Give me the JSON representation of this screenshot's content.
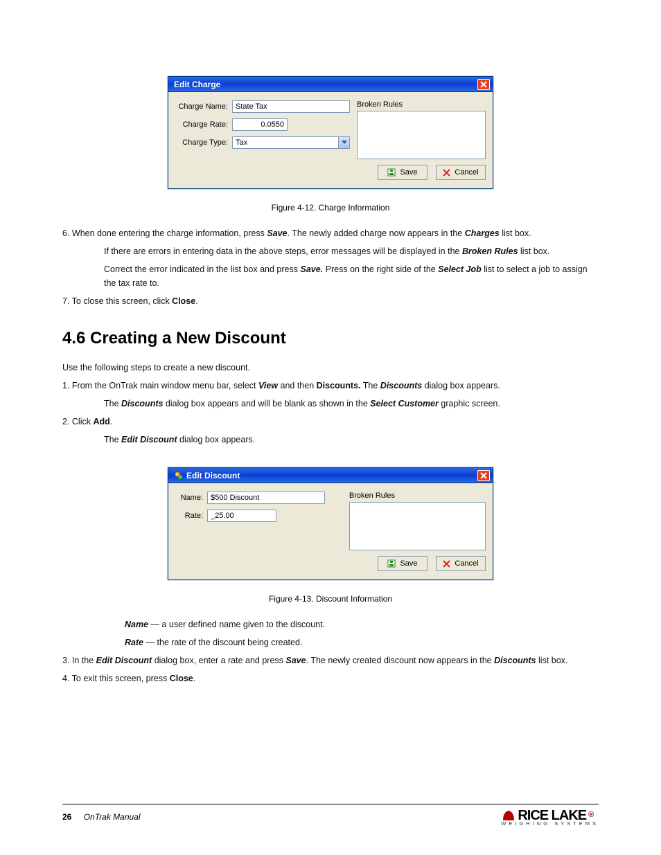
{
  "dialog1": {
    "title": "Edit Charge",
    "close_icon": "close-icon",
    "labels": {
      "name": "Charge Name:",
      "rate": "Charge Rate:",
      "type": "Charge Type:"
    },
    "values": {
      "name": "State Tax",
      "rate": "0.0550",
      "type": "Tax"
    },
    "broken_label": "Broken Rules",
    "save": "Save",
    "cancel": "Cancel"
  },
  "caption1": "Figure 4-12. Charge Information",
  "text1": {
    "step6a": "6. When done entering the charge information, press ",
    "step6b": ". The newly added charge now appears in the ",
    "listbox": "Charges",
    "step6c": " list box.",
    "note1a": "If there are errors in entering data in the above steps, error messages will be displayed in the ",
    "broken": "Broken Rules",
    "note1b": " list box.",
    "note2a": "Correct the error indicated in the list box and press ",
    "note2b": "Press on the right side of the ",
    "selectjob": "Select Job",
    "note2c": " list to select a job to assign the tax rate to.",
    "step7a": "7. To close this screen, click ",
    "close": "Close"
  },
  "heading": "4.6    Creating a New Discount",
  "text2": {
    "intro": "Use the following steps to create a new discount.",
    "step1a": "1. From the OnTrak main window menu bar, select ",
    "view": "View",
    "step1b": " and then ",
    "discounts": "Discounts.",
    "step1c": " The ",
    "discounts2": "Discounts",
    "step1d": " dialog box appears.",
    "step1e": " The ",
    "discounts3": "Discounts",
    "step1f": " dialog box appears and will be blank as shown in the ",
    "selectcust": "Select Customer",
    "step1g": " graphic screen.",
    "step2a": "2. Click ",
    "add": "Add",
    "step2b": ".",
    "step2c": " The ",
    "editdisc": "Edit Discount",
    "step2d": " dialog box appears."
  },
  "dialog2": {
    "title": "Edit Discount",
    "labels": {
      "name": "Name:",
      "rate": "Rate:"
    },
    "values": {
      "name": "$500 Discount",
      "rate": "_25.00"
    },
    "broken_label": "Broken Rules",
    "save": "Save",
    "cancel": "Cancel"
  },
  "caption2": "Figure 4-13. Discount Information",
  "text3": {
    "name_l": "Name",
    "name_t": " — a user defined name given to the discount.",
    "rate_l": "Rate",
    "rate_t": " — the rate of the discount being created.",
    "step3a": "3. In the ",
    "editdisc": "Edit Discount",
    "step3b": " dialog box, enter a rate and press ",
    "save": "Save",
    "step3c": ". The newly created discount now appears in the ",
    "discounts": "Discounts",
    "step3d": " list box.",
    "step4a": "4. To exit this screen, press ",
    "close": "Close",
    "step4b": "."
  },
  "footer": {
    "page": "26",
    "manual": "OnTrak Manual",
    "brand": "RICE LAKE",
    "sub": "WEIGHING SYSTEMS"
  }
}
